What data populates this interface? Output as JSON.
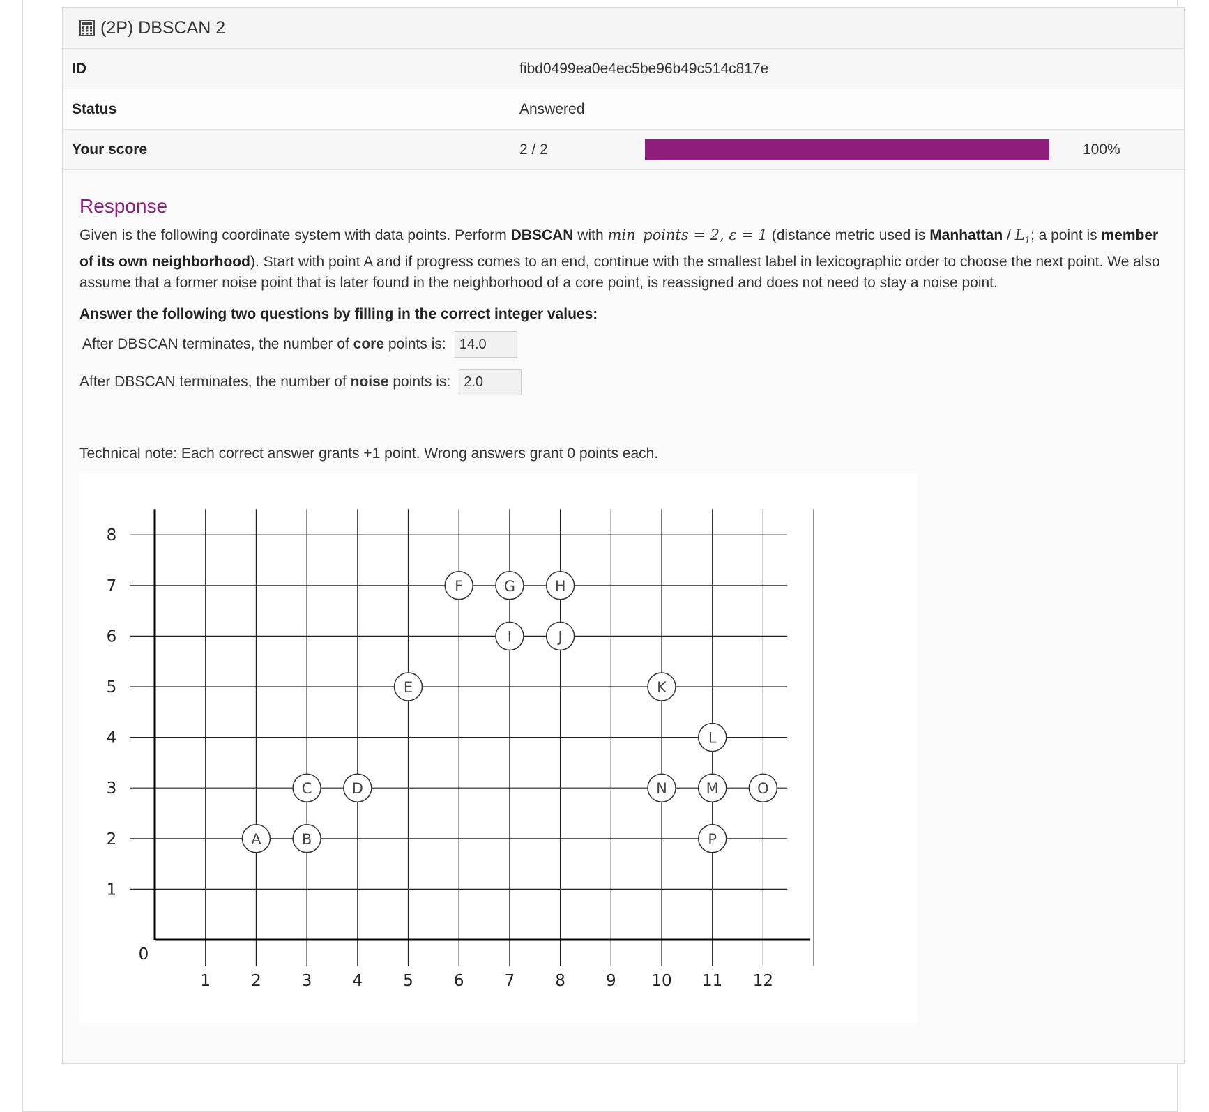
{
  "header": {
    "title": "(2P) DBSCAN 2",
    "icon": "calculator-icon"
  },
  "info": {
    "id_label": "ID",
    "id_value": "fibd0499ea0e4ec5be96b49c514c817e",
    "status_label": "Status",
    "status_value": "Answered",
    "score_label": "Your score",
    "score_value": "2 / 2",
    "score_fraction": 1.0,
    "score_pct": "100%",
    "bar_color": "#8e1e7c"
  },
  "response": {
    "heading": "Response",
    "q1": "Given is the following coordinate system with data points. Perform ",
    "q_dbscan": "DBSCAN",
    "q2": " with ",
    "q_params": "min_points = 2, ε = 1",
    "q3": " (distance metric used is ",
    "q_metric": "Manhattan",
    "q4": " / ",
    "q_l1": "L",
    "q_l1_sub": "1",
    "q5": "; a point is ",
    "q_member": "member of its own neighborhood",
    "q6": "). Start with point A and if progress comes to an end, continue with the smallest label in lexicographic order to choose the next point. We also assume that a former noise point that is later found in the neighborhood of a core point, is reassigned and does not need to stay a noise point.",
    "instruction": "Answer the following two questions by filling in the correct integer values:",
    "core_prefix": "After DBSCAN terminates, the number of ",
    "core_word": "core",
    "core_suffix": " points is:",
    "core_value": "14.0",
    "noise_prefix": "After DBSCAN terminates, the number of ",
    "noise_word": "noise",
    "noise_suffix": " points is:",
    "noise_value": "2.0",
    "note": "Technical note: Each correct answer grants +1 point. Wrong answers grant 0 points each."
  },
  "chart_data": {
    "type": "scatter",
    "title": "",
    "xlabel": "",
    "ylabel": "",
    "xlim": [
      0,
      13
    ],
    "ylim": [
      0,
      8
    ],
    "x_ticks": [
      1,
      2,
      3,
      4,
      5,
      6,
      7,
      8,
      9,
      10,
      11,
      12
    ],
    "y_ticks": [
      1,
      2,
      3,
      4,
      5,
      6,
      7,
      8
    ],
    "origin_label": "0",
    "grid": true,
    "points": [
      {
        "label": "A",
        "x": 2,
        "y": 2
      },
      {
        "label": "B",
        "x": 3,
        "y": 2
      },
      {
        "label": "C",
        "x": 3,
        "y": 3
      },
      {
        "label": "D",
        "x": 4,
        "y": 3
      },
      {
        "label": "E",
        "x": 5,
        "y": 5
      },
      {
        "label": "F",
        "x": 6,
        "y": 7
      },
      {
        "label": "G",
        "x": 7,
        "y": 7
      },
      {
        "label": "H",
        "x": 8,
        "y": 7
      },
      {
        "label": "I",
        "x": 7,
        "y": 6
      },
      {
        "label": "J",
        "x": 8,
        "y": 6
      },
      {
        "label": "K",
        "x": 10,
        "y": 5
      },
      {
        "label": "L",
        "x": 11,
        "y": 4
      },
      {
        "label": "M",
        "x": 11,
        "y": 3
      },
      {
        "label": "N",
        "x": 10,
        "y": 3
      },
      {
        "label": "O",
        "x": 12,
        "y": 3
      },
      {
        "label": "P",
        "x": 11,
        "y": 2
      }
    ]
  }
}
